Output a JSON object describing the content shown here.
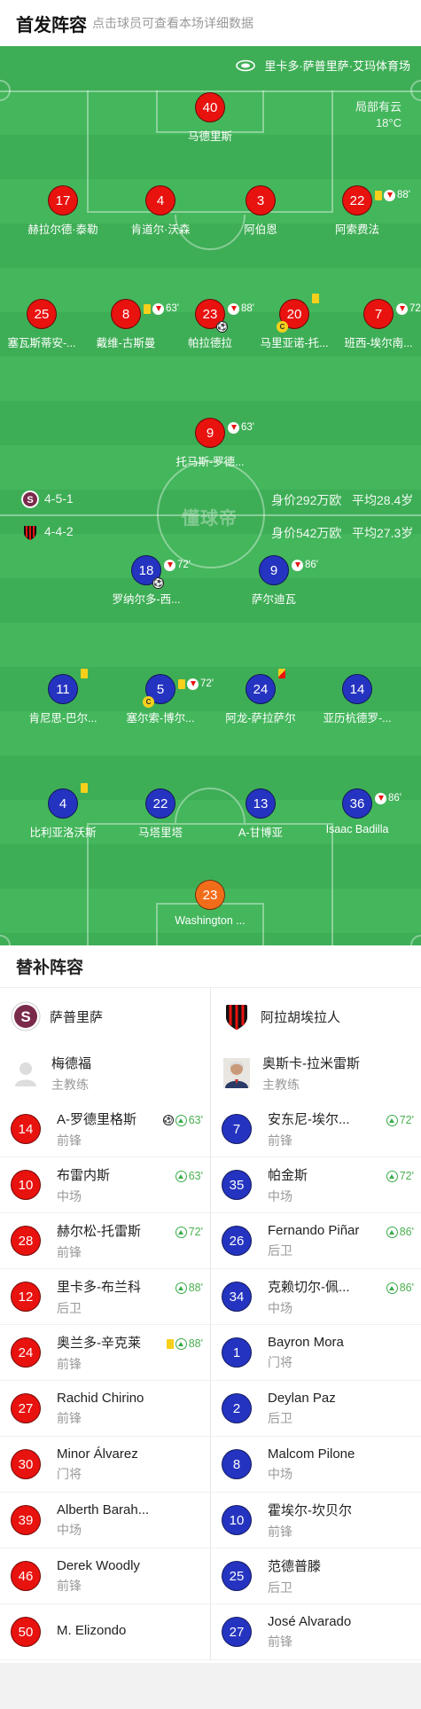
{
  "header": {
    "title": "首发阵容",
    "hint": "点击球员可查看本场详细数据"
  },
  "venue": {
    "name": "里卡多·萨普里萨·艾玛体育场",
    "icon": "stadium-icon"
  },
  "weather": {
    "desc": "局部有云",
    "temp": "18°C"
  },
  "watermark": "懂球帝",
  "home": {
    "name": "萨普里萨",
    "formation": "4-5-1",
    "value": "身价292万欧",
    "avg_age": "平均28.4岁",
    "colors": {
      "kit": "#e8120f"
    },
    "players": {
      "gk": {
        "num": "40",
        "name": "马德里斯"
      },
      "d1": {
        "num": "17",
        "name": "赫拉尔德·泰勒"
      },
      "d2": {
        "num": "4",
        "name": "肯道尔·沃森"
      },
      "d3": {
        "num": "3",
        "name": "阿伯恩"
      },
      "d4": {
        "num": "22",
        "name": "阿索费法",
        "min": "88'"
      },
      "m1": {
        "num": "25",
        "name": "塞瓦斯蒂安-..."
      },
      "m2": {
        "num": "8",
        "name": "戴维-古斯曼",
        "min": "63'"
      },
      "m3": {
        "num": "23",
        "name": "帕拉德拉",
        "min": "88'",
        "goal": "⚽"
      },
      "m4": {
        "num": "20",
        "name": "马里亚诺-托...",
        "cap": "C"
      },
      "m5": {
        "num": "7",
        "name": "班西-埃尔南...",
        "min": "72'"
      },
      "f1": {
        "num": "9",
        "name": "托马斯-罗德...",
        "min": "63'"
      }
    },
    "subs": [
      {
        "num": "14",
        "name": "A-罗德里格斯",
        "pos": "前锋",
        "min": "63'",
        "goal": "⚽"
      },
      {
        "num": "10",
        "name": "布雷内斯",
        "pos": "中场",
        "min": "63'"
      },
      {
        "num": "28",
        "name": "赫尔松-托雷斯",
        "pos": "前锋",
        "min": "72'"
      },
      {
        "num": "12",
        "name": "里卡多-布兰科",
        "pos": "后卫",
        "min": "88'"
      },
      {
        "num": "24",
        "name": "奥兰多-辛克莱",
        "pos": "前锋",
        "min": "88'",
        "card": "yellow"
      },
      {
        "num": "27",
        "name": "Rachid Chirino",
        "pos": "前锋"
      },
      {
        "num": "30",
        "name": "Minor Álvarez",
        "pos": "门将"
      },
      {
        "num": "39",
        "name": "Alberth Barah...",
        "pos": "中场"
      },
      {
        "num": "46",
        "name": "Derek Woodly",
        "pos": "前锋"
      },
      {
        "num": "50",
        "name": "M. Elizondo",
        "pos": ""
      }
    ],
    "coach": {
      "name": "梅德福",
      "role": "主教练"
    }
  },
  "away": {
    "name": "阿拉胡埃拉人",
    "formation": "4-4-2",
    "value": "身价542万欧",
    "avg_age": "平均27.3岁",
    "colors": {
      "kit": "#2534c0",
      "gk": "#f26d1a"
    },
    "players": {
      "f1": {
        "num": "18",
        "name": "罗纳尔多-西...",
        "min": "72'",
        "goal": "⚽"
      },
      "f2": {
        "num": "9",
        "name": "萨尔迪瓦",
        "min": "86'"
      },
      "m1": {
        "num": "11",
        "name": "肯尼思-巴尔..."
      },
      "m2": {
        "num": "5",
        "name": "塞尔索-博尔...",
        "min": "72'",
        "cap": "C"
      },
      "m3": {
        "num": "24",
        "name": "阿龙-萨拉萨尔"
      },
      "m4": {
        "num": "14",
        "name": "亚历杭德罗-..."
      },
      "d1": {
        "num": "4",
        "name": "比利亚洛沃斯"
      },
      "d2": {
        "num": "22",
        "name": "马塔里塔"
      },
      "d3": {
        "num": "13",
        "name": "A-甘博亚"
      },
      "d4": {
        "num": "36",
        "name": "Isaac Badilla",
        "min": "86'"
      },
      "gk": {
        "num": "23",
        "name": "Washington ..."
      }
    },
    "subs": [
      {
        "num": "7",
        "name": "安东尼-埃尔...",
        "pos": "前锋",
        "min": "72'"
      },
      {
        "num": "35",
        "name": "帕金斯",
        "pos": "中场",
        "min": "72'"
      },
      {
        "num": "26",
        "name": "Fernando Piñar",
        "pos": "后卫",
        "min": "86'"
      },
      {
        "num": "34",
        "name": "克赖切尔-佩...",
        "pos": "中场",
        "min": "86'"
      },
      {
        "num": "1",
        "name": "Bayron Mora",
        "pos": "门将"
      },
      {
        "num": "2",
        "name": "Deylan Paz",
        "pos": "后卫"
      },
      {
        "num": "8",
        "name": "Malcom Pilone",
        "pos": "中场"
      },
      {
        "num": "10",
        "name": "霍埃尔-坎贝尔",
        "pos": "前锋"
      },
      {
        "num": "25",
        "name": "范德普滕",
        "pos": "后卫"
      },
      {
        "num": "27",
        "name": "José Alvarado",
        "pos": "前锋"
      }
    ],
    "coach": {
      "name": "奥斯卡-拉米雷斯",
      "role": "主教练"
    }
  },
  "subs_title": "替补阵容"
}
